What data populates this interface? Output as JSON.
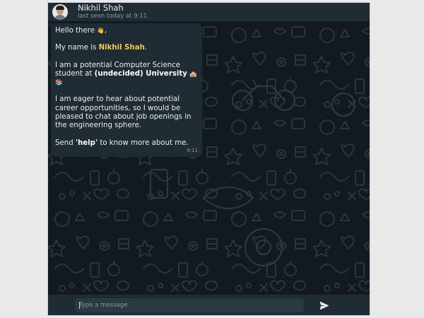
{
  "header": {
    "contact_name": "Nikhil Shah",
    "last_seen": "last seen today at 9:11",
    "avatar_icon": "person-photo"
  },
  "message": {
    "greeting": "Hello there ",
    "greeting_emoji": "👋",
    "greeting_suffix": ",",
    "intro_prefix": "My name is ",
    "name_highlight": "Nikhil Shah",
    "intro_suffix": ".",
    "study_text": "I am a potential Computer Science student at ",
    "university": "(undecided) University",
    "study_emojis": "🏫 📚",
    "career_text": "I am eager to hear about potential career opportunities, so I would be pleased to chat about job openings in the engineering sphere.",
    "help_prefix": "Send ",
    "help_keyword": "'help'",
    "help_suffix": " to know more about me.",
    "time": "9:11"
  },
  "composer": {
    "placeholder": "Type a message",
    "send_icon": "send-icon"
  },
  "colors": {
    "header_bg": "#202c33",
    "chat_bg": "#111a20",
    "bubble_bg": "#202c33",
    "highlight": "#f2c94c",
    "text": "#e9edef",
    "muted": "#8696a0"
  }
}
